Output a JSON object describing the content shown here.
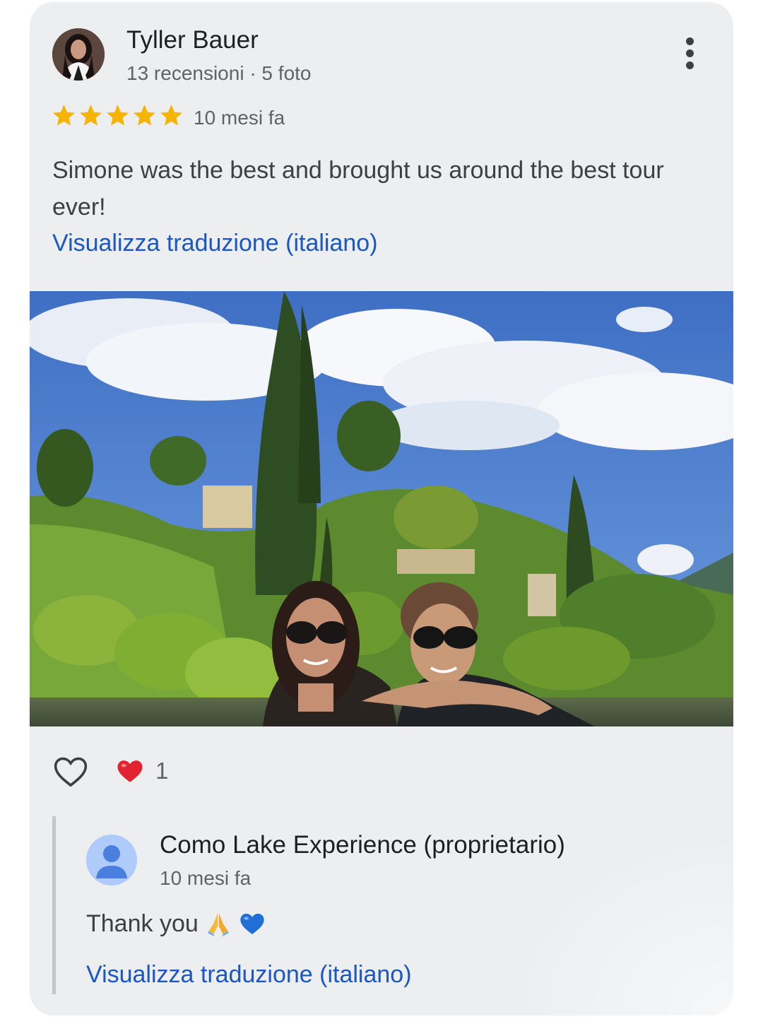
{
  "review": {
    "author_name": "Tyller Bauer",
    "author_meta": "13 recensioni · 5 foto",
    "rating": 5,
    "time": "10 mesi fa",
    "text": "Simone was the best and brought us around the best tour ever!",
    "translate_link": "Visualizza traduzione (italiano)",
    "more_icon": "more-vert-icon"
  },
  "reactions": {
    "like_icon": "heart-outline-icon",
    "reaction_icon": "red-heart-icon",
    "count": "1"
  },
  "owner_reply": {
    "name": "Como Lake Experience (proprietario)",
    "time": "10 mesi fa",
    "text": "Thank you",
    "emojis": [
      "folded-hands",
      "blue-heart"
    ],
    "translate_link": "Visualizza traduzione (italiano)"
  },
  "colors": {
    "link": "#1a56c4",
    "star": "#f5b400",
    "card_bg": "#eceef0"
  }
}
